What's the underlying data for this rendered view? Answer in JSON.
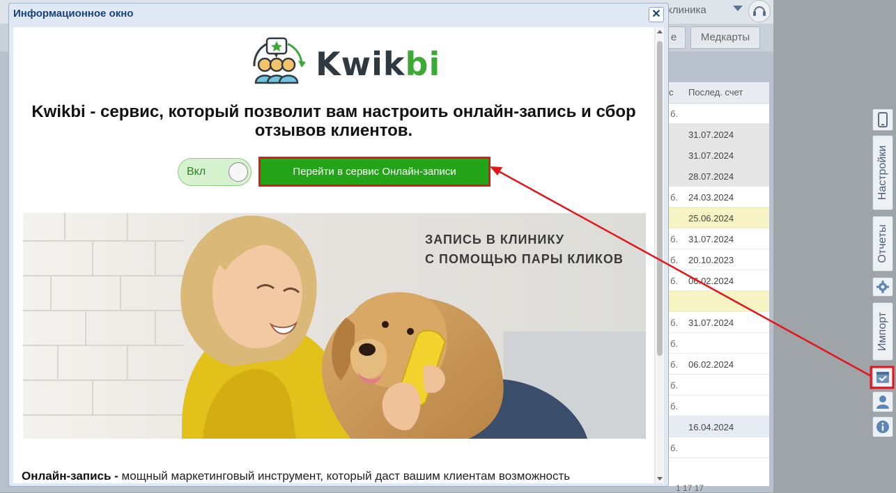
{
  "background": {
    "clinic_select": "клиника",
    "tabs": [
      {
        "label": "е"
      },
      {
        "label": "Медкарты"
      }
    ],
    "grid": {
      "columns": [
        "с",
        "Послед. счет"
      ],
      "rows": [
        {
          "suffix": "б.",
          "date": ""
        },
        {
          "suffix": "",
          "date": "31.07.2024"
        },
        {
          "suffix": "",
          "date": "31.07.2024"
        },
        {
          "suffix": "",
          "date": "28.07.2024"
        },
        {
          "suffix": "б.",
          "date": "24.03.2024"
        },
        {
          "suffix": "",
          "date": "25.06.2024"
        },
        {
          "suffix": "б.",
          "date": "31.07.2024"
        },
        {
          "suffix": "б.",
          "date": "20.10.2023"
        },
        {
          "suffix": "б.",
          "date": "06.02.2024"
        },
        {
          "suffix": "",
          "date": ""
        },
        {
          "suffix": "б.",
          "date": "31.07.2024"
        },
        {
          "suffix": "б.",
          "date": ""
        },
        {
          "suffix": "б.",
          "date": "06.02.2024"
        },
        {
          "suffix": "б.",
          "date": ""
        },
        {
          "suffix": "б.",
          "date": ""
        },
        {
          "suffix": "",
          "date": "16.04.2024"
        },
        {
          "suffix": "б.",
          "date": ""
        }
      ],
      "pager": "1    17    17"
    }
  },
  "side_panel": {
    "settings_label": "Настройки",
    "reports_label": "Отчеты",
    "import_label": "Импорт"
  },
  "modal": {
    "title": "Информационное окно",
    "close_label": "✕",
    "logo_text_dark": "Kwik",
    "logo_text_green": "bi",
    "headline": "Kwikbi - сервис, который позволит вам настроить онлайн-запись и сбор отзывов клиентов.",
    "toggle_label": "Вкл",
    "cta_label": "Перейти в сервис Онлайн-записи",
    "banner_line1": "ЗАПИСЬ В КЛИНИКУ",
    "banner_line2": "С ПОМОЩЬЮ ПАРЫ КЛИКОВ",
    "desc_bold": "Онлайн-запись -",
    "desc_text": " мощный маркетинговый инструмент, который даст вашим клиентам возможность"
  },
  "colors": {
    "cta_green": "#24a418",
    "brand_green": "#3aaa35",
    "highlight_red": "#e3141a",
    "title_blue": "#16437a"
  }
}
